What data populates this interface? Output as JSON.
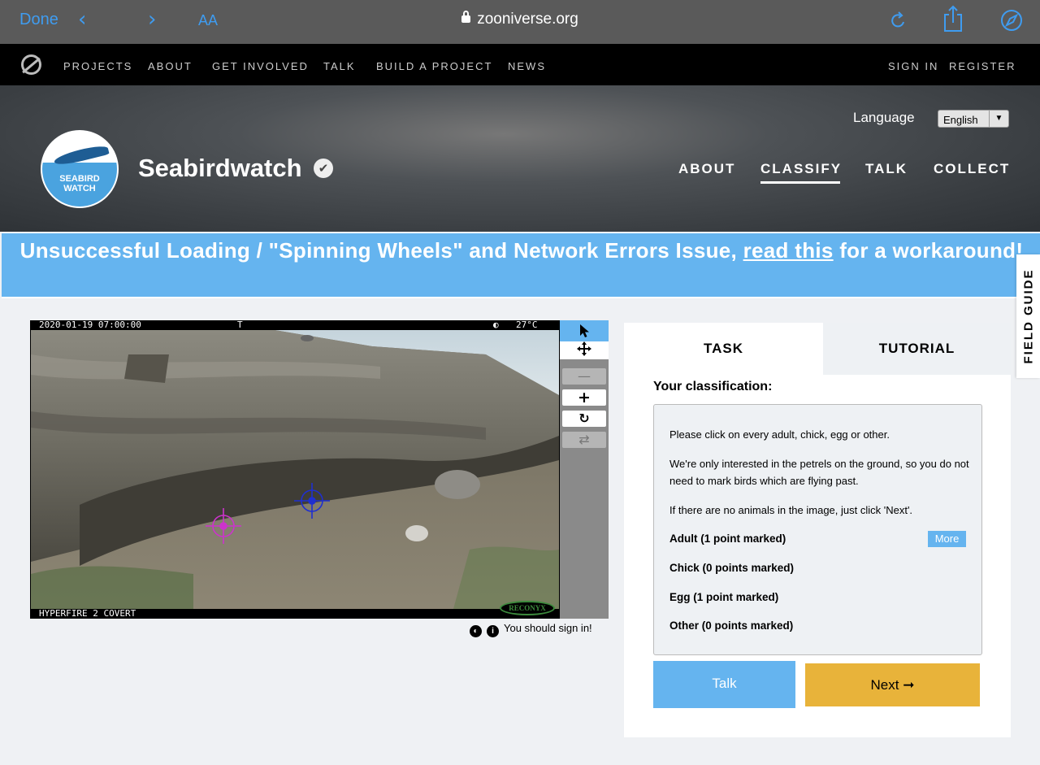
{
  "safari": {
    "done": "Done",
    "text_size": "AA",
    "url": "zooniverse.org",
    "icons": [
      "back-icon",
      "forward-icon",
      "reload-icon",
      "share-icon",
      "compass-icon",
      "lock-icon"
    ]
  },
  "zoo_nav": {
    "items": [
      "PROJECTS",
      "ABOUT",
      "GET INVOLVED",
      "TALK",
      "BUILD A PROJECT",
      "NEWS"
    ],
    "sign_in": "SIGN IN",
    "register": "REGISTER"
  },
  "project": {
    "title": "Seabirdwatch",
    "avatar_text_1": "SEABIRD",
    "avatar_text_2": "WATCH",
    "language_label": "Language",
    "language_value": "English",
    "nav": [
      "ABOUT",
      "CLASSIFY",
      "TALK",
      "COLLECT"
    ],
    "active_nav": "CLASSIFY"
  },
  "announcement": {
    "before": "Unsuccessful Loading / \"Spinning Wheels\" and Network Errors Issue, ",
    "link": "read this",
    "after": " for a workaround!"
  },
  "field_guide": "FIELD GUIDE",
  "subject": {
    "timestamp": "2020-01-19 07:00:00",
    "flag": "T",
    "temperature": "27°C",
    "camera_model": "HYPERFIRE 2 COVERT",
    "brand": "RECONYX",
    "marks": [
      {
        "type": "adult",
        "color": "#cc33cc"
      },
      {
        "type": "egg",
        "color": "#1f2fd0"
      }
    ]
  },
  "toolbar": {
    "tools": [
      "pointer-icon",
      "move-icon",
      "zoom-out-icon",
      "zoom-in-icon",
      "rotate-icon",
      "reset-icon"
    ]
  },
  "signin_note": "You should sign in!",
  "task_panel": {
    "tab_task": "TASK",
    "tab_tutorial": "TUTORIAL",
    "your_classification": "Your classification:",
    "instructions": [
      "Please click on every adult, chick, egg or other.",
      "We're only interested in the petrels on the ground, so you do not need to mark birds which are flying past.",
      "If there are no animals in the image, just click 'Next'."
    ],
    "options": [
      "Adult (1 point marked)",
      "Chick (0 points marked)",
      "Egg (1 point marked)",
      "Other (0 points marked)"
    ],
    "more": "More",
    "talk": "Talk",
    "next": "Next ➞"
  },
  "colors": {
    "accent_blue": "#65b4ef",
    "next_yellow": "#e8b33a",
    "safari_blue": "#3f9cf0"
  }
}
